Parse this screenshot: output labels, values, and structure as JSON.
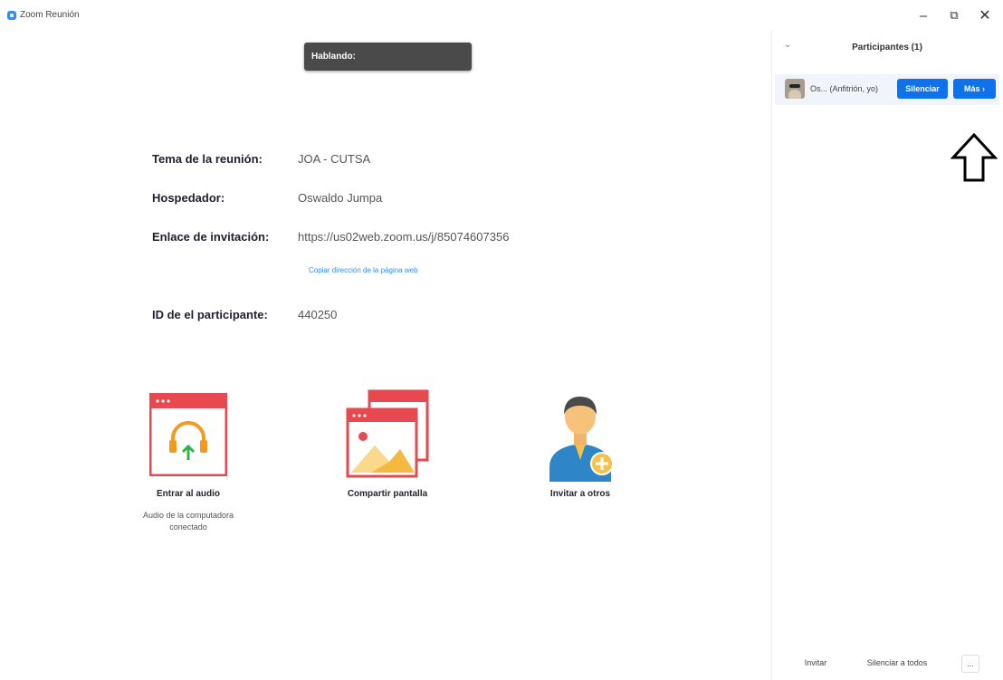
{
  "window": {
    "title": "Zoom Reunión",
    "minimize_label": "–",
    "restore_label": "⧉",
    "close_label": "✕"
  },
  "speaking": {
    "label": "Hablando:"
  },
  "meeting_info": {
    "topic_label": "Tema de la reunión:",
    "topic_value": "JOA - CUTSA",
    "host_label": "Hospedador:",
    "host_value": "Oswaldo Jumpa",
    "invite_label": "Enlace de invitación:",
    "invite_value": "https://us02web.zoom.us/j/85074607356",
    "copy_link": "Copiar dirección de la página web",
    "participant_id_label": "ID de el participante:",
    "participant_id_value": "440250"
  },
  "actions": {
    "audio_label": "Entrar al audio",
    "audio_sub": "Audio de la computadora conectado",
    "share_label": "Compartir pantalla",
    "invite_label": "Invitar a otros"
  },
  "participants_panel": {
    "collapse_icon": "chevron-down-icon",
    "title": "Participantes (1)",
    "participant": {
      "name": "Os... (Anfitrión, yo)",
      "mute_button": "Silenciar",
      "more_button": "Más ›"
    },
    "footer": {
      "invite": "Invitar",
      "mute_all": "Silenciar a todos",
      "more": "..."
    }
  },
  "colors": {
    "accent": "#0e72ed",
    "link": "#2D8CFF",
    "speaking_bg": "#4a4a4a",
    "icon_red": "#e8484f",
    "headphones_orange": "#f29a1d",
    "arrow_green": "#2fb24a"
  }
}
